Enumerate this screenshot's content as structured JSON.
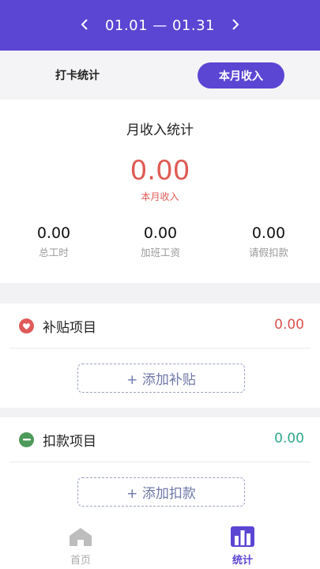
{
  "header": {
    "prev_icon": "chevron-left-icon",
    "date_range": "01.01 — 01.31",
    "next_icon": "chevron-right-icon",
    "background": "#5b45d3"
  },
  "tabs": {
    "punch_stats": "打卡统计",
    "monthly_income": "本月收入"
  },
  "summary": {
    "title": "月收入统计",
    "income_value": "0.00",
    "income_label": "本月收入",
    "stats": [
      {
        "value": "0.00",
        "label": "总工时"
      },
      {
        "value": "0.00",
        "label": "加班工资"
      },
      {
        "value": "0.00",
        "label": "请假扣款"
      }
    ]
  },
  "allowance": {
    "title": "补贴项目",
    "amount": "0.00",
    "amount_color": "#d9534f",
    "add_label": "+ 添加补贴"
  },
  "deduction": {
    "title": "扣款项目",
    "amount": "0.00",
    "amount_color": "#2ea88a",
    "add_label": "+ 添加扣款"
  },
  "nav": {
    "home": "首页",
    "stats": "统计",
    "active_color": "#5b45d3"
  }
}
